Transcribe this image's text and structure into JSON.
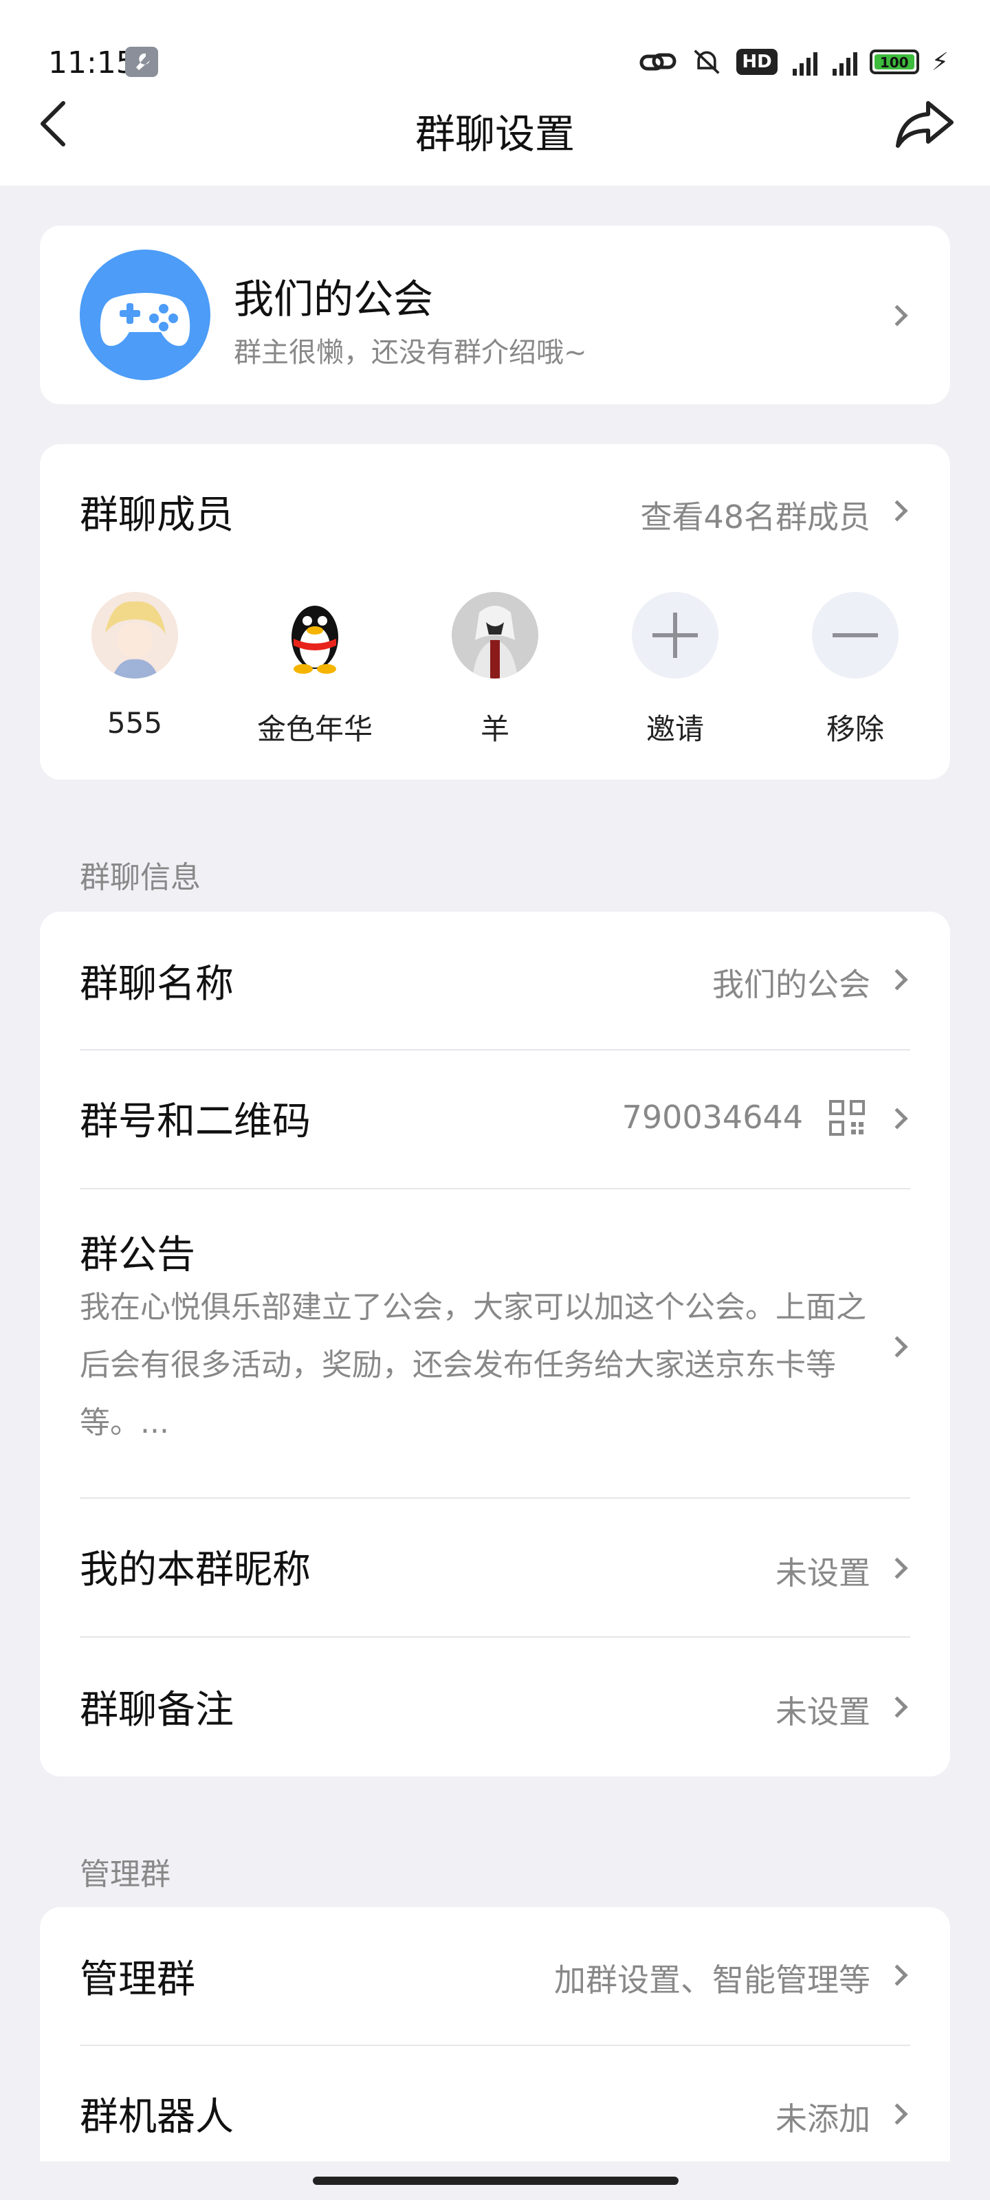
{
  "status": {
    "time": "11:15",
    "hd": "HD",
    "network1": "5G",
    "network2": "5G",
    "battery": "100"
  },
  "nav": {
    "title": "群聊设置"
  },
  "group": {
    "name": "我们的公会",
    "description": "群主很懒，还没有群介绍哦~"
  },
  "members": {
    "title": "群聊成员",
    "view_all": "查看48名群成员",
    "items": [
      {
        "name": "555"
      },
      {
        "name": "金色年华"
      },
      {
        "name": "羊"
      },
      {
        "name": "邀请"
      },
      {
        "name": "移除"
      }
    ]
  },
  "info_section": {
    "label": "群聊信息",
    "group_name_title": "群聊名称",
    "group_name_value": "我们的公会",
    "group_id_title": "群号和二维码",
    "group_id_value": "790034644",
    "notice_title": "群公告",
    "notice_text": "我在心悦俱乐部建立了公会，大家可以加这个公会。上面之后会有很多活动，奖励，还会发布任务给大家送京东卡等等。...",
    "nickname_title": "我的本群昵称",
    "nickname_value": "未设置",
    "remark_title": "群聊备注",
    "remark_value": "未设置"
  },
  "manage_section": {
    "label": "管理群",
    "manage_title": "管理群",
    "manage_value": "加群设置、智能管理等",
    "robot_title": "群机器人",
    "robot_value": "未添加"
  }
}
